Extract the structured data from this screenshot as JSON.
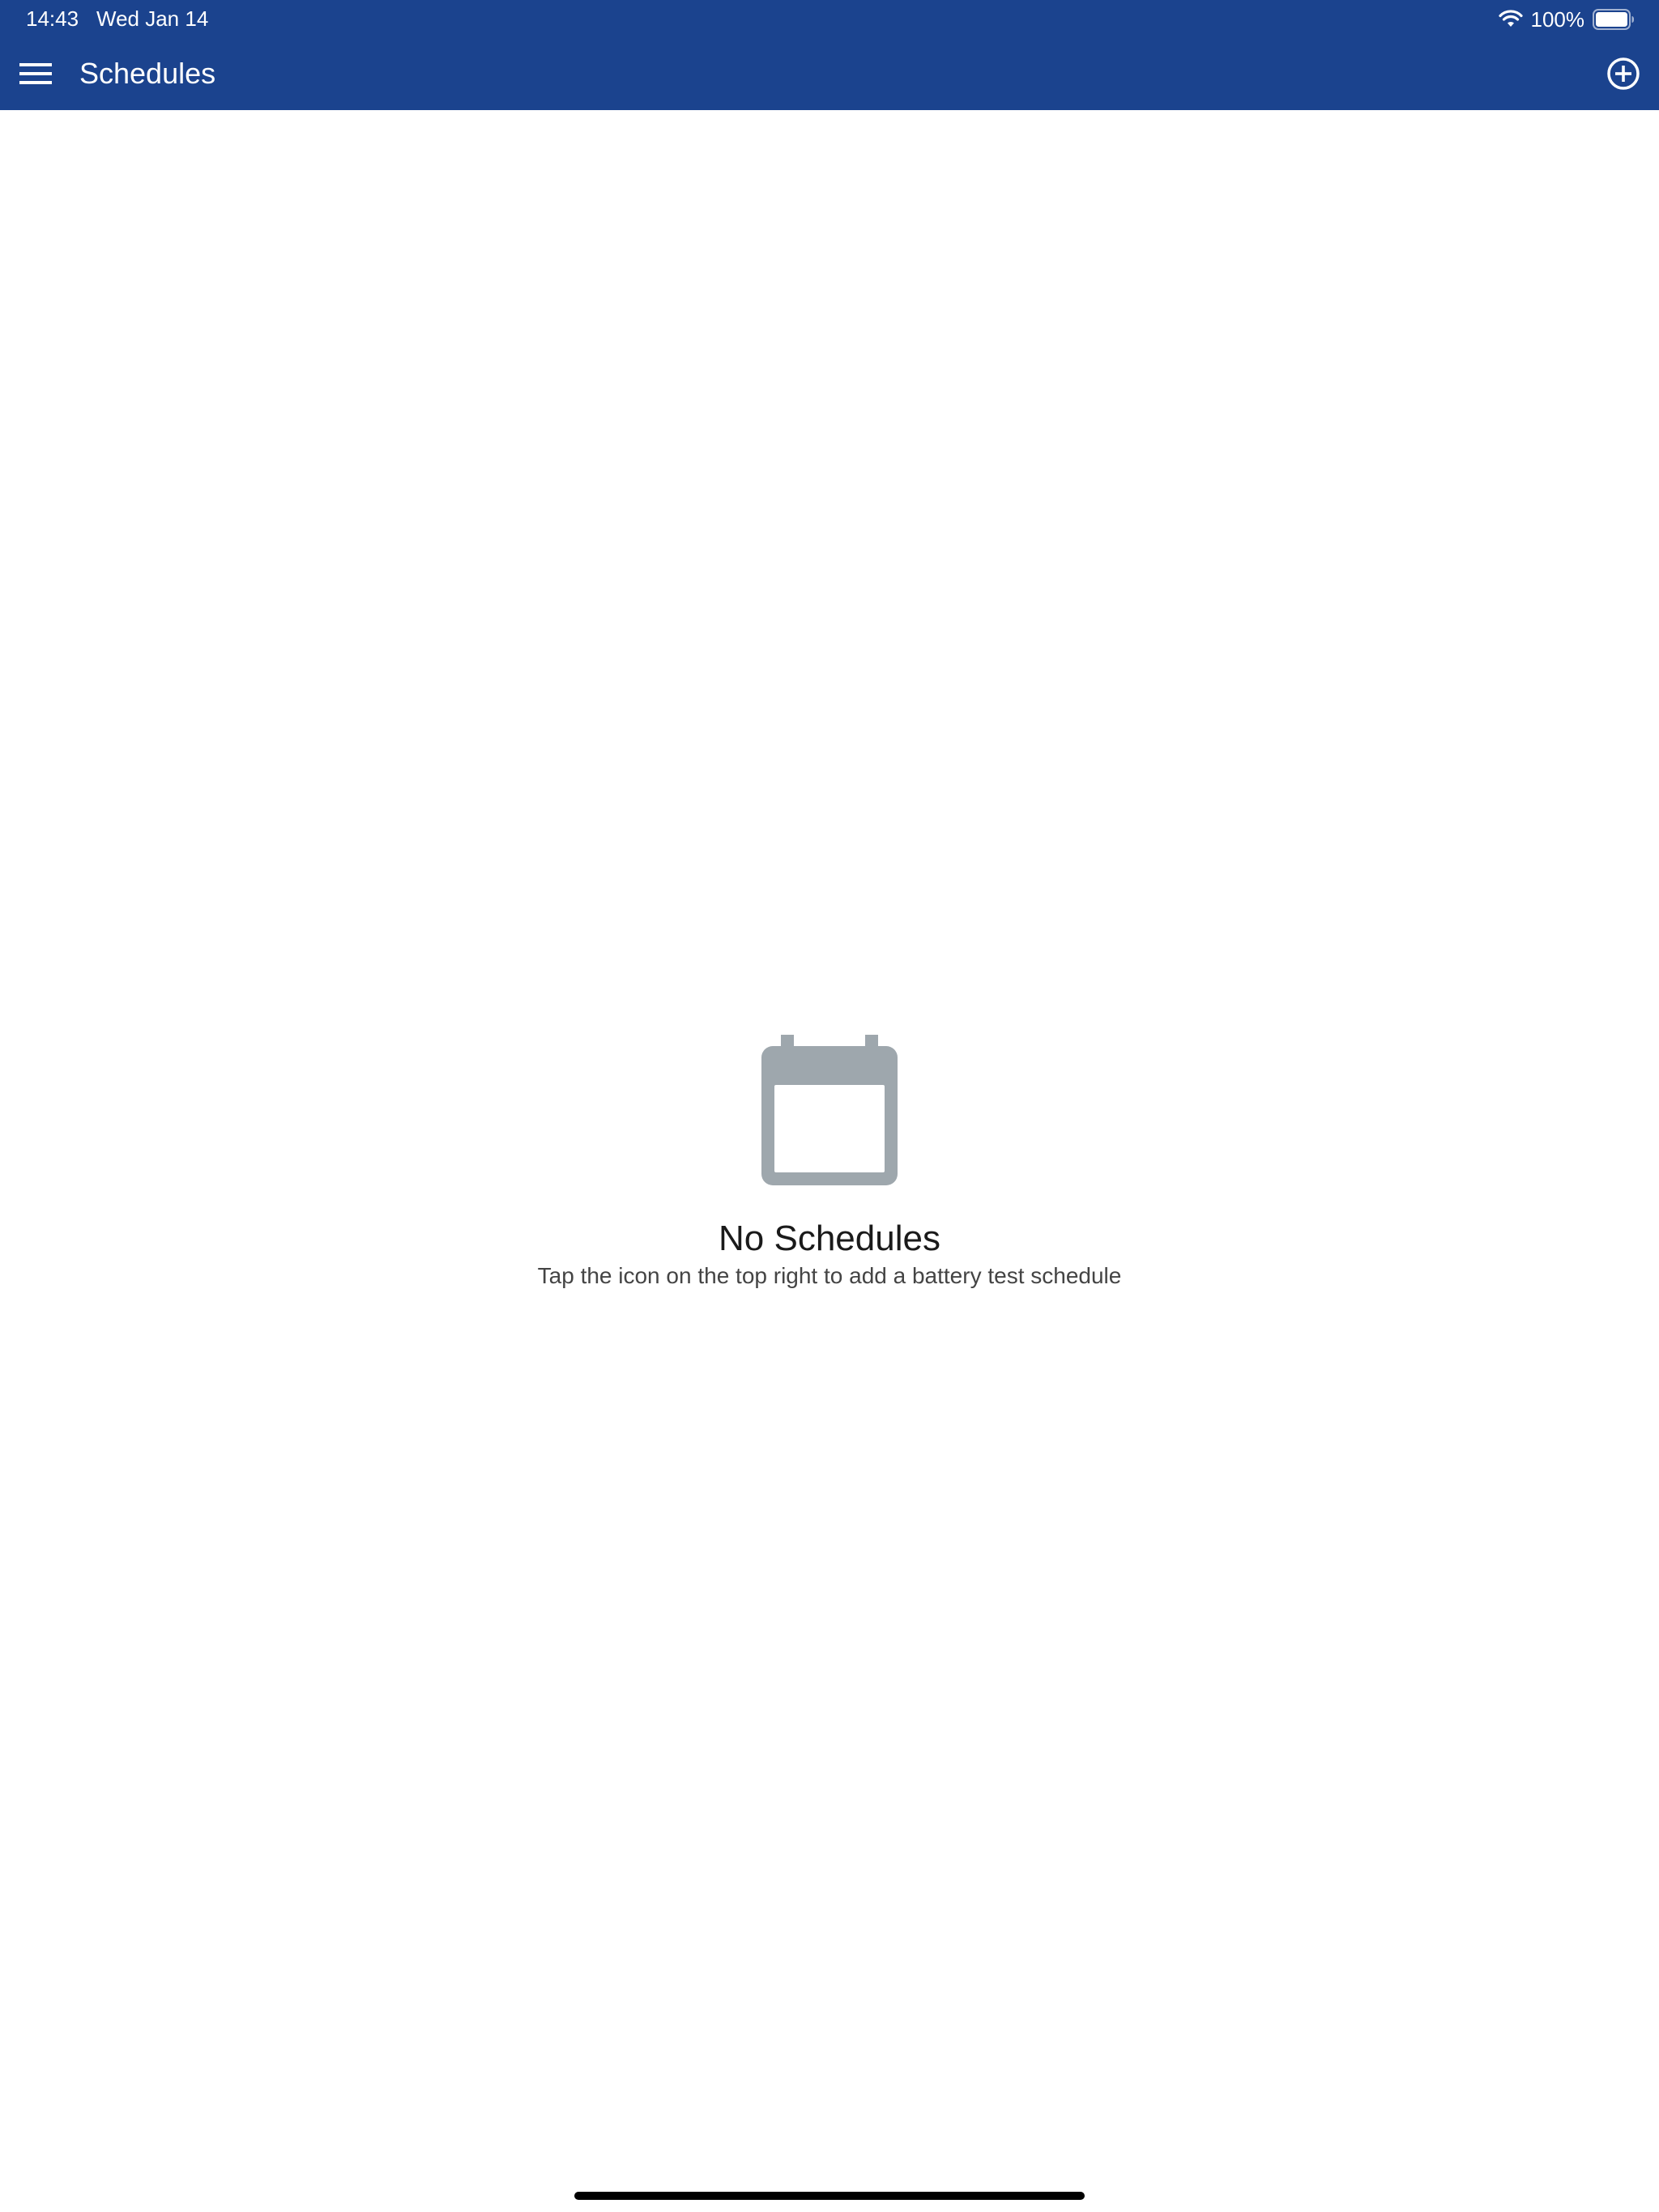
{
  "status_bar": {
    "time": "14:43",
    "date": "Wed Jan 14",
    "battery_percent": "100%",
    "wifi_icon": "wifi-icon",
    "battery_icon": "battery-full-icon"
  },
  "app_bar": {
    "title": "Schedules",
    "menu_icon": "hamburger-menu-icon",
    "add_icon": "plus-circle-icon"
  },
  "empty_state": {
    "icon": "calendar-icon",
    "title": "No Schedules",
    "subtitle": "Tap the icon on the top right to add a battery test schedule"
  },
  "colors": {
    "primary": "#1b438e",
    "icon_gray": "#9ea7ad",
    "text_dark": "#1a1a1a",
    "text_muted": "#444444"
  }
}
